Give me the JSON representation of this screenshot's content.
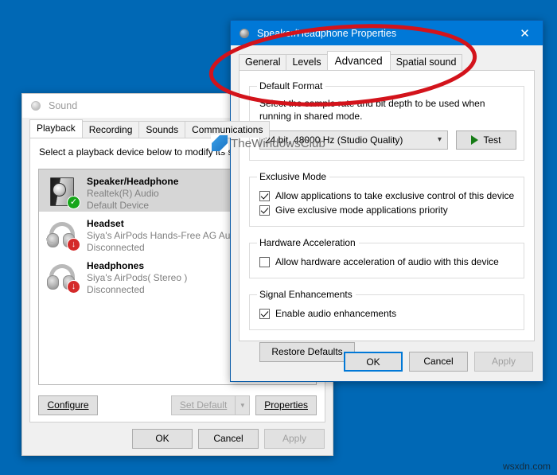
{
  "desktop": {
    "background_color": "#0068b5"
  },
  "sound_window": {
    "title": "Sound",
    "icon": "speaker-icon",
    "tabs": [
      {
        "label": "Playback",
        "active": true
      },
      {
        "label": "Recording",
        "active": false
      },
      {
        "label": "Sounds",
        "active": false
      },
      {
        "label": "Communications",
        "active": false
      }
    ],
    "hint": "Select a playback device below to modify its sett",
    "devices": [
      {
        "name": "Speaker/Headphone",
        "driver": "Realtek(R) Audio",
        "status": "Default Device",
        "icon": "speaker-device-icon",
        "badge": "check-badge",
        "badge_glyph": "✓",
        "selected": true
      },
      {
        "name": "Headset",
        "driver": "Siya's AirPods Hands-Free AG Audi",
        "status": "Disconnected",
        "icon": "headset-device-icon",
        "badge": "disconnected-badge",
        "badge_glyph": "↓",
        "selected": false
      },
      {
        "name": "Headphones",
        "driver": "Siya's AirPods( Stereo )",
        "status": "Disconnected",
        "icon": "headphones-device-icon",
        "badge": "disconnected-badge",
        "badge_glyph": "↓",
        "selected": false
      }
    ],
    "buttons": {
      "configure": "Configure",
      "set_default": "Set Default",
      "set_default_enabled": false,
      "properties": "Properties",
      "ok": "OK",
      "cancel": "Cancel",
      "apply": "Apply",
      "apply_enabled": false
    }
  },
  "properties_dialog": {
    "title": "Speaker/Headphone Properties",
    "icon": "speaker-icon",
    "close_glyph": "✕",
    "accent_color": "#0078d7",
    "tabs": [
      {
        "label": "General",
        "active": false
      },
      {
        "label": "Levels",
        "active": false
      },
      {
        "label": "Advanced",
        "active": true
      },
      {
        "label": "Spatial sound",
        "active": false
      }
    ],
    "default_format": {
      "legend": "Default Format",
      "description": "Select the sample rate and bit depth to be used when running in shared mode.",
      "selected_value": "24 bit, 48000 Hz (Studio Quality)",
      "chevron": "⌵",
      "test_label": "Test"
    },
    "exclusive_mode": {
      "legend": "Exclusive Mode",
      "options": [
        {
          "label": "Allow applications to take exclusive control of this device",
          "checked": true
        },
        {
          "label": "Give exclusive mode applications priority",
          "checked": true
        }
      ]
    },
    "hardware_acceleration": {
      "legend": "Hardware Acceleration",
      "options": [
        {
          "label": "Allow hardware acceleration of audio with this device",
          "checked": false
        }
      ]
    },
    "signal_enhancements": {
      "legend": "Signal Enhancements",
      "options": [
        {
          "label": "Enable audio enhancements",
          "checked": true
        }
      ]
    },
    "restore_defaults": "Restore Defaults",
    "buttons": {
      "ok": "OK",
      "cancel": "Cancel",
      "apply": "Apply",
      "apply_enabled": false
    }
  },
  "annotation": {
    "shape": "red-ellipse",
    "color": "#d3131b",
    "targets": "Advanced tab"
  },
  "watermarks": {
    "overlay": "TheWindowsClub",
    "corner": "wsxdn.com"
  }
}
